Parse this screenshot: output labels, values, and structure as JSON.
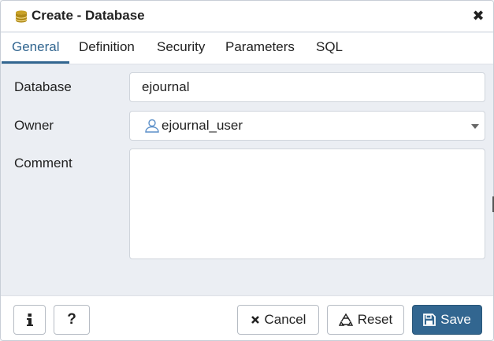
{
  "dialog": {
    "title": "Create - Database",
    "title_icon": "database-icon",
    "close_icon": "close-icon"
  },
  "tabs": [
    {
      "label": "General",
      "active": true
    },
    {
      "label": "Definition",
      "active": false
    },
    {
      "label": "Security",
      "active": false
    },
    {
      "label": "Parameters",
      "active": false
    },
    {
      "label": "SQL",
      "active": false
    }
  ],
  "form": {
    "database_label": "Database",
    "database_value": "ejournal",
    "owner_label": "Owner",
    "owner_value": "ejournal_user",
    "owner_icon": "user-icon",
    "comment_label": "Comment",
    "comment_value": ""
  },
  "footer": {
    "info_icon": "info-icon",
    "help_icon": "help-icon",
    "help_label": "?",
    "cancel_label": "Cancel",
    "reset_label": "Reset",
    "save_label": "Save"
  },
  "colors": {
    "accent": "#326690",
    "db_icon": "#c9a227",
    "user_icon": "#5b8fc9"
  }
}
